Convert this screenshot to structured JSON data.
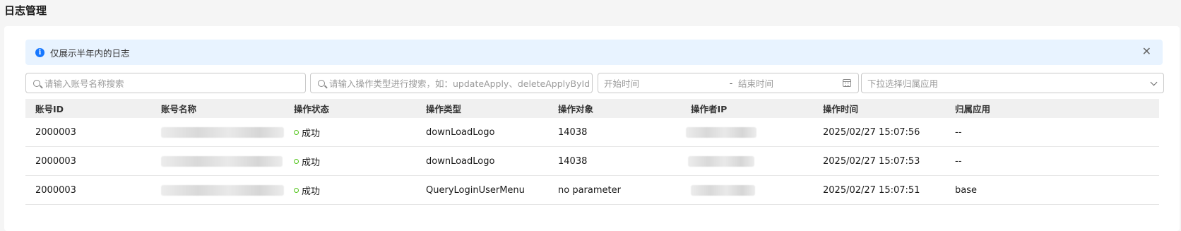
{
  "page": {
    "title": "日志管理"
  },
  "notice": {
    "text": "仅展示半年内的日志"
  },
  "filters": {
    "account_placeholder": "请输入账号名称搜索",
    "operation_placeholder": "请输入操作类型进行搜索，如：updateApply、deleteApplyById",
    "start_placeholder": "开始时间",
    "range_separator": "-",
    "end_placeholder": "结束时间",
    "app_placeholder": "下拉选择归属应用"
  },
  "table": {
    "headers": [
      "账号ID",
      "账号名称",
      "操作状态",
      "操作类型",
      "操作对象",
      "操作者IP",
      "操作时间",
      "归属应用"
    ],
    "rows": [
      {
        "account_id": "2000003",
        "status": "成功",
        "operation_type": "downLoadLogo",
        "target": "14038",
        "time": "2025/02/27 15:07:56",
        "app": "--"
      },
      {
        "account_id": "2000003",
        "status": "成功",
        "operation_type": "downLoadLogo",
        "target": "14038",
        "time": "2025/02/27 15:07:53",
        "app": "--"
      },
      {
        "account_id": "2000003",
        "status": "成功",
        "operation_type": "QueryLoginUserMenu",
        "target": "no parameter",
        "time": "2025/02/27 15:07:51",
        "app": "base"
      }
    ]
  },
  "colors": {
    "accent": "#1677ff",
    "success": "#52c41a",
    "notice_bg": "#e8f3ff"
  },
  "icons": [
    "info-icon",
    "close-icon",
    "search-icon",
    "calendar-icon",
    "chevron-down-icon",
    "status-dot-icon"
  ]
}
